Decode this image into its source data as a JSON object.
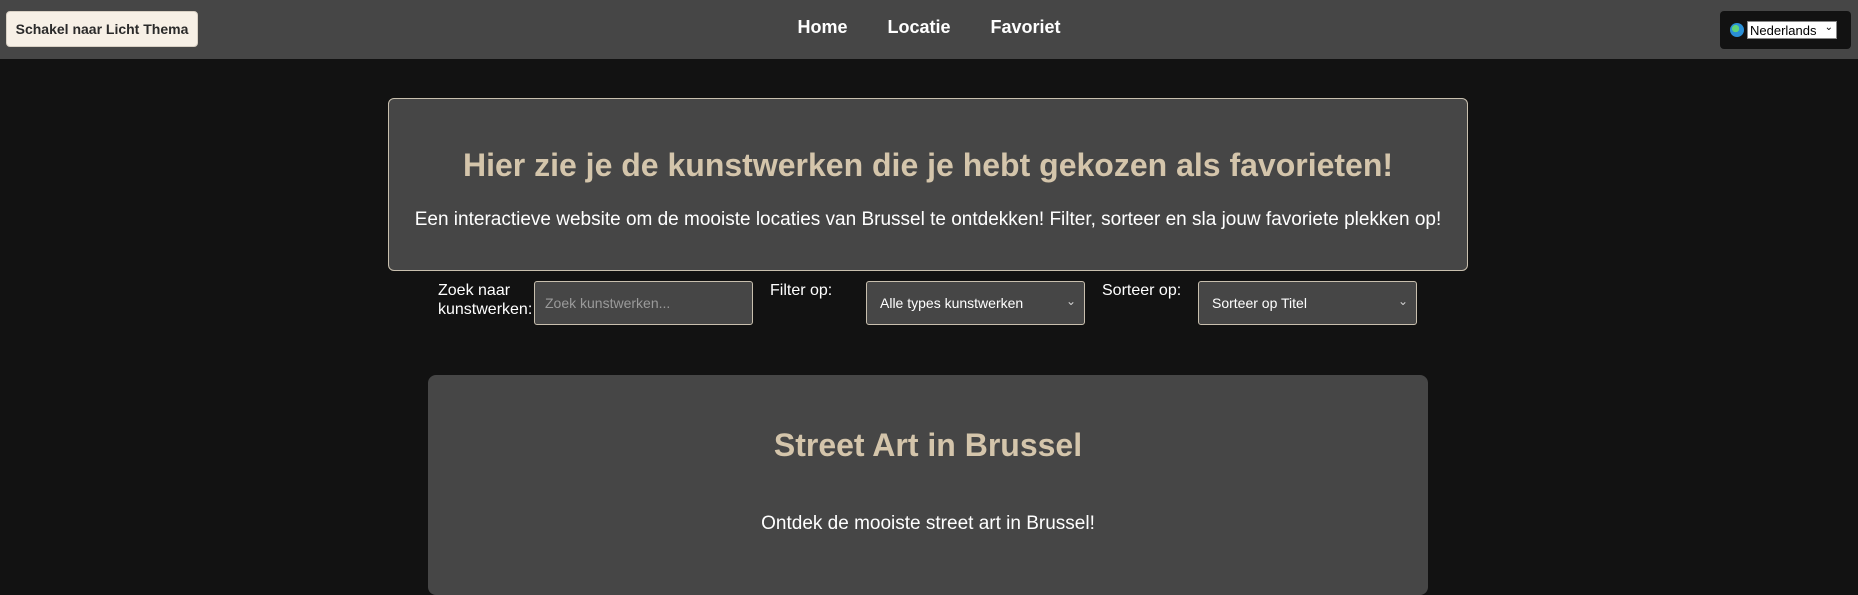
{
  "header": {
    "theme_button": "Schakel naar Licht Thema",
    "nav": [
      "Home",
      "Locatie",
      "Favoriet"
    ],
    "language": "Nederlands",
    "language_icon": "globe-icon"
  },
  "hero": {
    "title": "Hier zie je de kunstwerken die je hebt gekozen als favorieten!",
    "subtitle": "Een interactieve website om de mooiste locaties van Brussel te ontdekken! Filter, sorteer en sla jouw favoriete plekken op!"
  },
  "controls": {
    "search_label_line1": "Zoek naar",
    "search_label_line2": "kunstwerken:",
    "search_placeholder": "Zoek kunstwerken...",
    "filter_label": "Filter op:",
    "filter_value": "Alle types kunstwerken",
    "sort_label": "Sorteer op:",
    "sort_value": "Sorteer op Titel"
  },
  "card": {
    "title": "Street Art in Brussel",
    "text": "Ontdek de mooiste street art in Brussel!"
  },
  "colors": {
    "background": "#121212",
    "panel": "#464646",
    "accent_text": "#d4c5ab",
    "border": "#c8bfae"
  }
}
